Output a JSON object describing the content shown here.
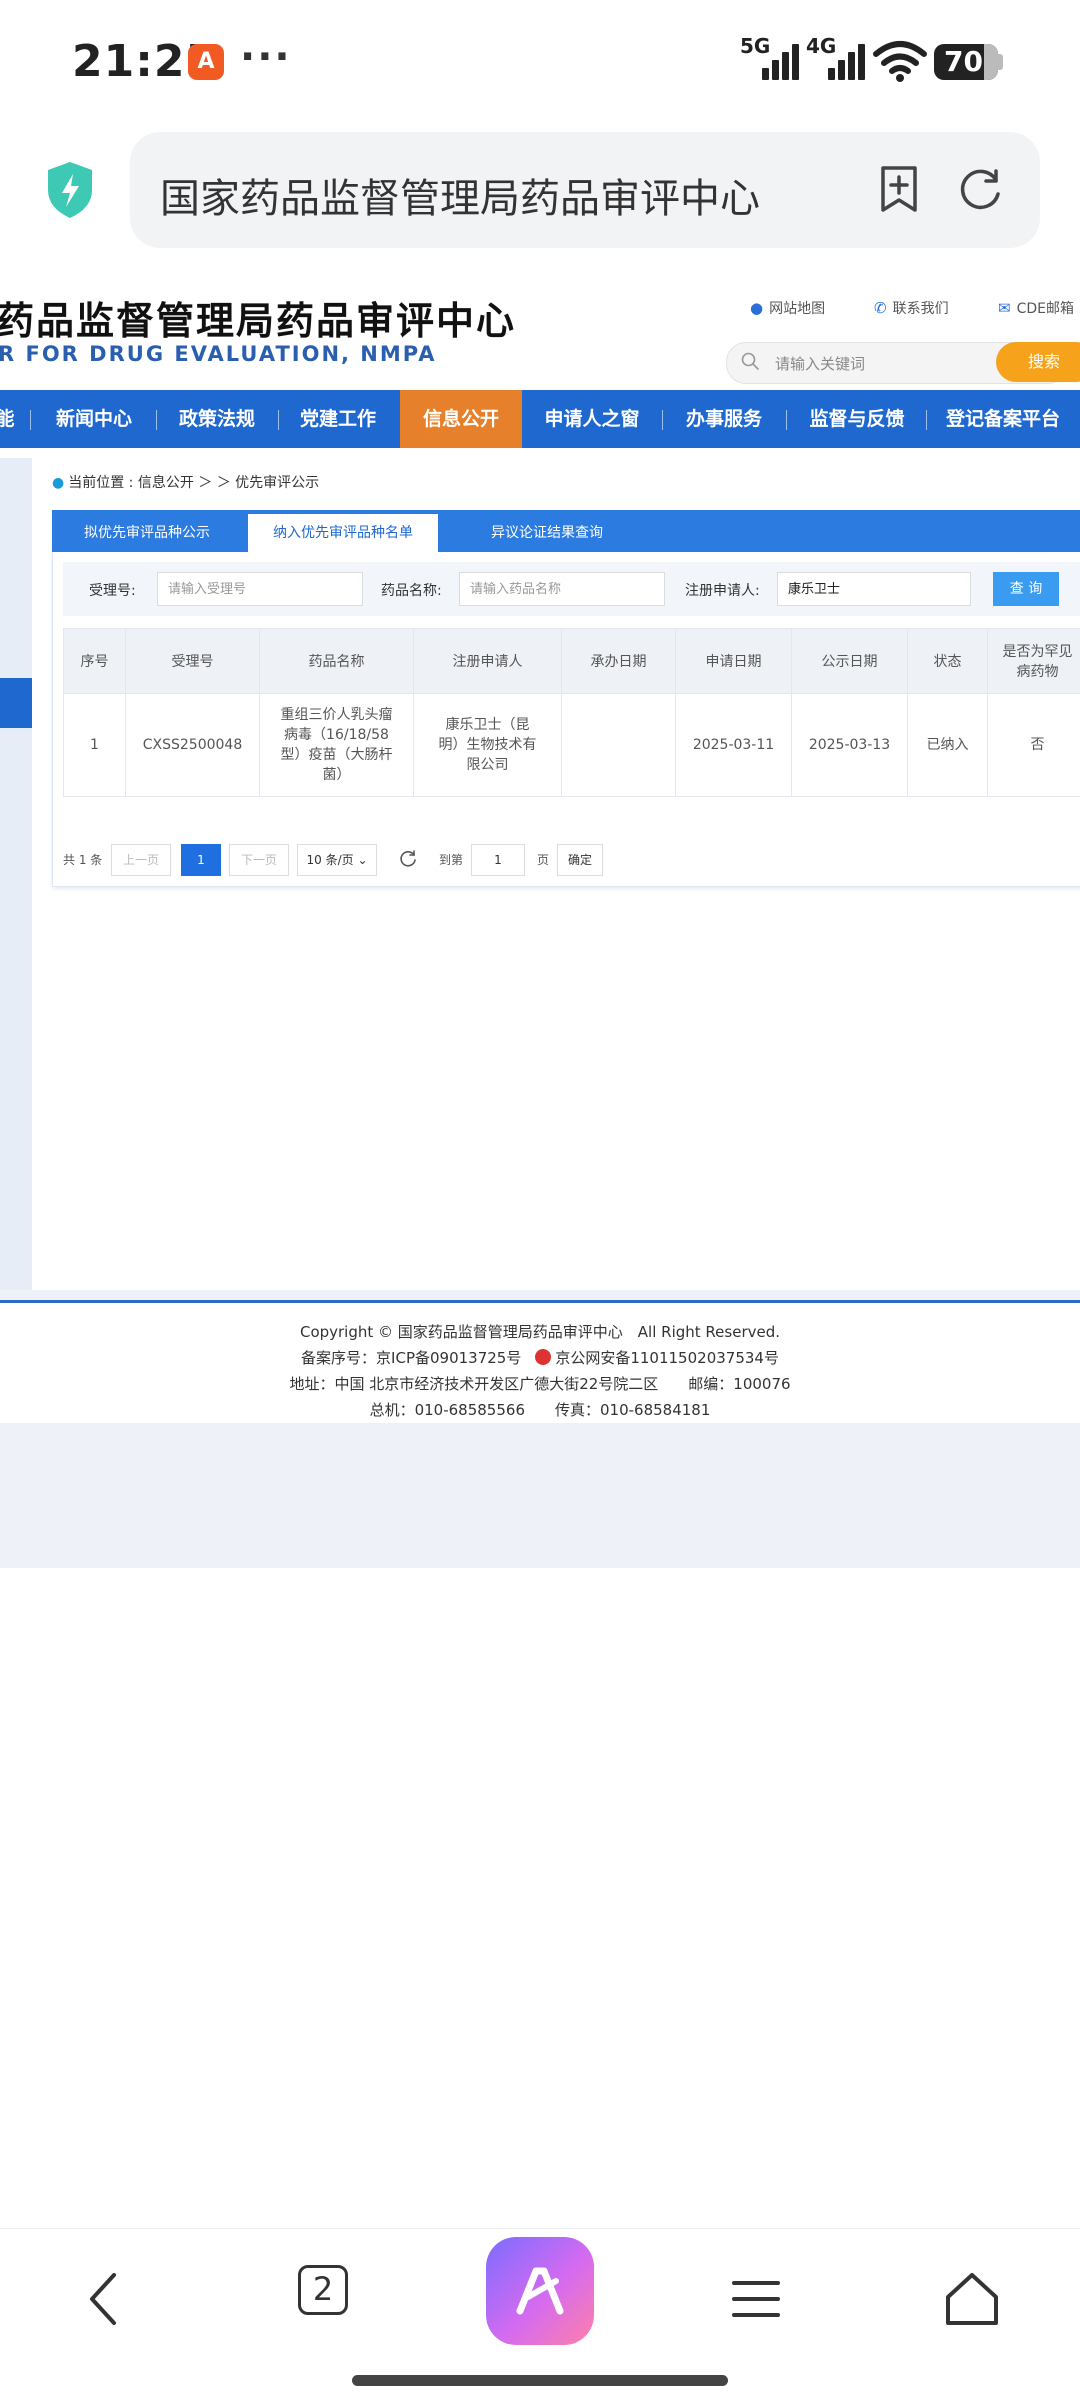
{
  "status_bar": {
    "time": "21:25",
    "app_badge": "A",
    "more": "···",
    "net1": "5G",
    "net2": "4G",
    "battery": "70"
  },
  "browser": {
    "url_title": "国家药品监督管理局药品审评中心"
  },
  "site": {
    "title": "药品监督管理局药品审评中心",
    "subtitle": "R FOR DRUG EVALUATION, NMPA",
    "top_links": [
      "网站地图",
      "联系我们",
      "CDE邮箱"
    ],
    "search_placeholder": "请输入关键词",
    "search_button": "搜索"
  },
  "nav": {
    "items": [
      "能",
      "新闻中心",
      "政策法规",
      "党建工作",
      "信息公开",
      "申请人之窗",
      "办事服务",
      "监督与反馈",
      "登记备案平台"
    ],
    "active": "信息公开"
  },
  "breadcrumb": "当前位置 : 信息公开 ＞ ＞ 优先审评公示",
  "tabs": [
    "拟优先审评品种公示",
    "纳入优先审评品种名单",
    "异议论证结果查询"
  ],
  "filters": {
    "accept_no_label": "受理号:",
    "accept_no_placeholder": "请输入受理号",
    "drug_name_label": "药品名称:",
    "drug_name_placeholder": "请输入药品名称",
    "applicant_label": "注册申请人:",
    "applicant_value": "康乐卫士",
    "query_button": "查 询"
  },
  "table": {
    "headers": [
      "序号",
      "受理号",
      "药品名称",
      "注册申请人",
      "承办日期",
      "申请日期",
      "公示日期",
      "状态",
      "是否为罕见病药物"
    ],
    "rows": [
      [
        "1",
        "CXSS2500048",
        "重组三价人乳头瘤病毒（16/18/58型）疫苗（大肠杆菌）",
        "康乐卫士（昆明）生物技术有限公司",
        "",
        "2025-03-11",
        "2025-03-13",
        "已纳入",
        "否"
      ]
    ]
  },
  "pager": {
    "total": "共 1 条",
    "prev": "上一页",
    "current": "1",
    "next": "下一页",
    "page_size": "10 条/页",
    "goto_label": "到第",
    "goto_value": "1",
    "page_unit": "页",
    "confirm": "确定"
  },
  "footer": {
    "copyright": "Copyright © 国家药品监督管理局药品审评中心　All Right Reserved.",
    "icp": "备案序号：京ICP备09013725号",
    "police": "京公网安备11011502037534号",
    "address": "地址：中国 北京市经济技术开发区广德大街22号院二区　　邮编：100076",
    "phones": "总机：010-68585566　　传真：010-68584181"
  },
  "bottom_bar": {
    "tab_count": "2"
  },
  "colors": {
    "nav_blue": "#1f68d0",
    "nav_active": "#e7802a",
    "search_orange": "#f7a21b",
    "query_blue": "#3a9cf0"
  }
}
